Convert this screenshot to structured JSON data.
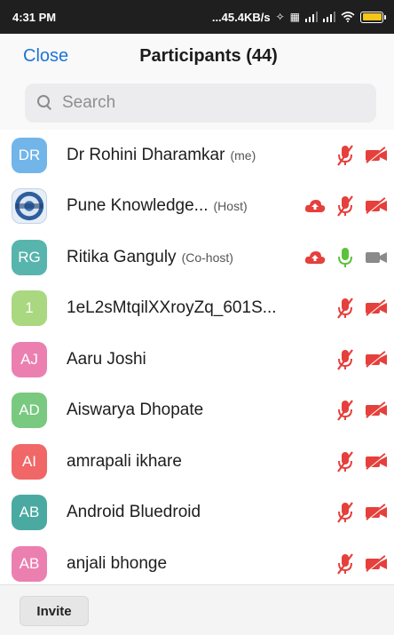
{
  "status_bar": {
    "time": "4:31 PM",
    "network_speed": "...45.4KB/s",
    "battery_color": "#f5c518"
  },
  "header": {
    "close_label": "Close",
    "title": "Participants (44)"
  },
  "search": {
    "placeholder": "Search"
  },
  "participants": [
    {
      "initials": "DR",
      "name": "Dr Rohini Dharamkar",
      "role": "(me)",
      "avatar_color": "#5aa9e6",
      "cloud": false,
      "mic": "muted",
      "video": "off"
    },
    {
      "initials": "",
      "name": "Pune Knowledge...",
      "role": "(Host)",
      "avatar_color": "#e6eef7",
      "cloud": true,
      "mic": "muted",
      "video": "off",
      "avatar_image": true
    },
    {
      "initials": "RG",
      "name": "Ritika Ganguly",
      "role": "(Co-host)",
      "avatar_color": "#3aa99f",
      "cloud": true,
      "mic": "on",
      "video": "idle"
    },
    {
      "initials": "1",
      "name": "1eL2sMtqilXXroyZq_601S...",
      "role": "",
      "avatar_color": "#9bd26b",
      "cloud": false,
      "mic": "muted",
      "video": "off"
    },
    {
      "initials": "AJ",
      "name": "Aaru Joshi",
      "role": "",
      "avatar_color": "#e86aa3",
      "cloud": false,
      "mic": "muted",
      "video": "off"
    },
    {
      "initials": "AD",
      "name": "Aiswarya Dhopate",
      "role": "",
      "avatar_color": "#62c06b",
      "cloud": false,
      "mic": "muted",
      "video": "off"
    },
    {
      "initials": "AI",
      "name": "amrapali ikhare",
      "role": "",
      "avatar_color": "#ef4d4d",
      "cloud": false,
      "mic": "muted",
      "video": "off"
    },
    {
      "initials": "AB",
      "name": "Android Bluedroid",
      "role": "",
      "avatar_color": "#2b9c92",
      "cloud": false,
      "mic": "muted",
      "video": "off"
    },
    {
      "initials": "AB",
      "name": "anjali bhonge",
      "role": "",
      "avatar_color": "#e86aa3",
      "cloud": false,
      "mic": "muted",
      "video": "off"
    }
  ],
  "footer": {
    "invite_label": "Invite"
  },
  "colors": {
    "accent": "#1e74d6",
    "muted_red": "#e5403c",
    "mic_on_green": "#5cc23a",
    "video_idle_gray": "#8a8a8a"
  }
}
